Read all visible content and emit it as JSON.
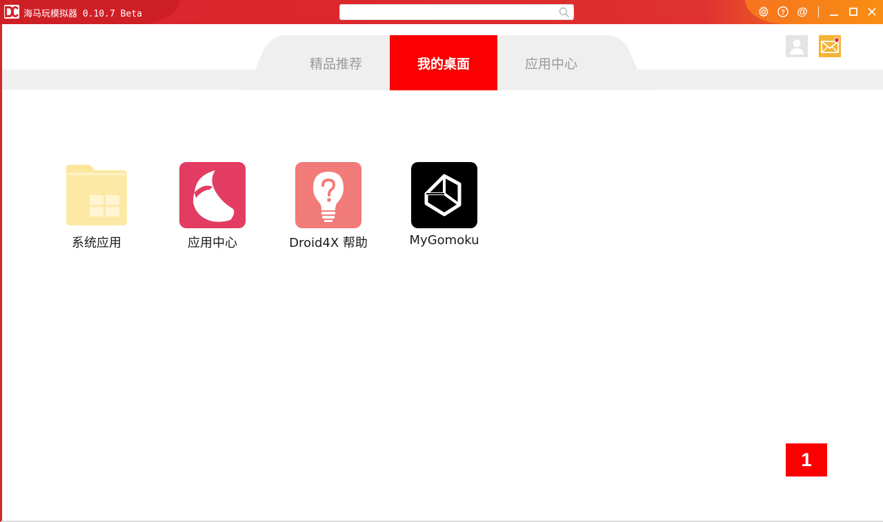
{
  "window": {
    "title": "海马玩模拟器 0.10.7 Beta",
    "search_placeholder": "",
    "search_value": ""
  },
  "titlebar_icons": [
    "gear-icon",
    "help-icon",
    "at-icon",
    "minimize-icon",
    "maximize-icon",
    "close-icon"
  ],
  "tabs": [
    {
      "label": "精品推荐",
      "active": false
    },
    {
      "label": "我的桌面",
      "active": true
    },
    {
      "label": "应用中心",
      "active": false
    }
  ],
  "desktop": {
    "apps": [
      {
        "label": "系统应用",
        "icon": "folder-icon"
      },
      {
        "label": "应用中心",
        "icon": "app-center-icon"
      },
      {
        "label": "Droid4X 帮助",
        "icon": "help-bulb-icon"
      },
      {
        "label": "MyGomoku",
        "icon": "unity-icon"
      }
    ],
    "page_number": "1"
  },
  "colors": {
    "brand_red": "#fa0000",
    "titlebar_red": "#d9232b",
    "titlebar_orange": "#f78f17",
    "mail_yellow": "#f5b335"
  }
}
